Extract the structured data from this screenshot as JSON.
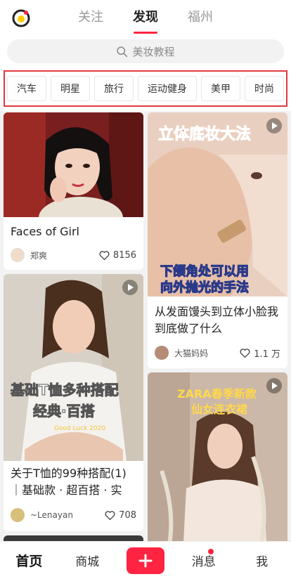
{
  "top_tabs": [
    {
      "label": "关注",
      "active": false
    },
    {
      "label": "发现",
      "active": true
    },
    {
      "label": "福州",
      "active": false
    }
  ],
  "search": {
    "placeholder": "美妆教程"
  },
  "categories": [
    "汽车",
    "明星",
    "旅行",
    "运动健身",
    "美甲",
    "时尚"
  ],
  "cards": [
    {
      "title": "Faces of Girl",
      "author": "郑爽",
      "likes": "8156",
      "has_play": false,
      "overlay": []
    },
    {
      "title": "从发面馒头到立体小脸我到底做了什么",
      "author": "大猫妈妈",
      "likes": "1.1 万",
      "has_play": true,
      "overlay": [
        "立体底妆大法",
        "下颌角处可以用",
        "向外抛光的手法"
      ]
    },
    {
      "title": "关于T恤的99种搭配(1) ｜基础款 · 超百搭 · 实",
      "author": "~Lenayan",
      "likes": "708",
      "has_play": true,
      "overlay": [
        "基础T恤多种搭配",
        "经典·百搭",
        "Good Luck 2020"
      ]
    },
    {
      "title": "",
      "author": "",
      "likes": "",
      "has_play": true,
      "overlay": [
        "ZARA春季新款",
        "仙女连衣裙"
      ]
    }
  ],
  "bottom_nav": [
    {
      "label": "首页",
      "active": true
    },
    {
      "label": "商城",
      "active": false
    },
    {
      "label": "",
      "icon": "plus-icon"
    },
    {
      "label": "消息",
      "active": false,
      "badge_dot": true
    },
    {
      "label": "我",
      "active": false
    }
  ],
  "colors": {
    "accent": "#ff2442",
    "highlight_frame": "#e0393e"
  }
}
